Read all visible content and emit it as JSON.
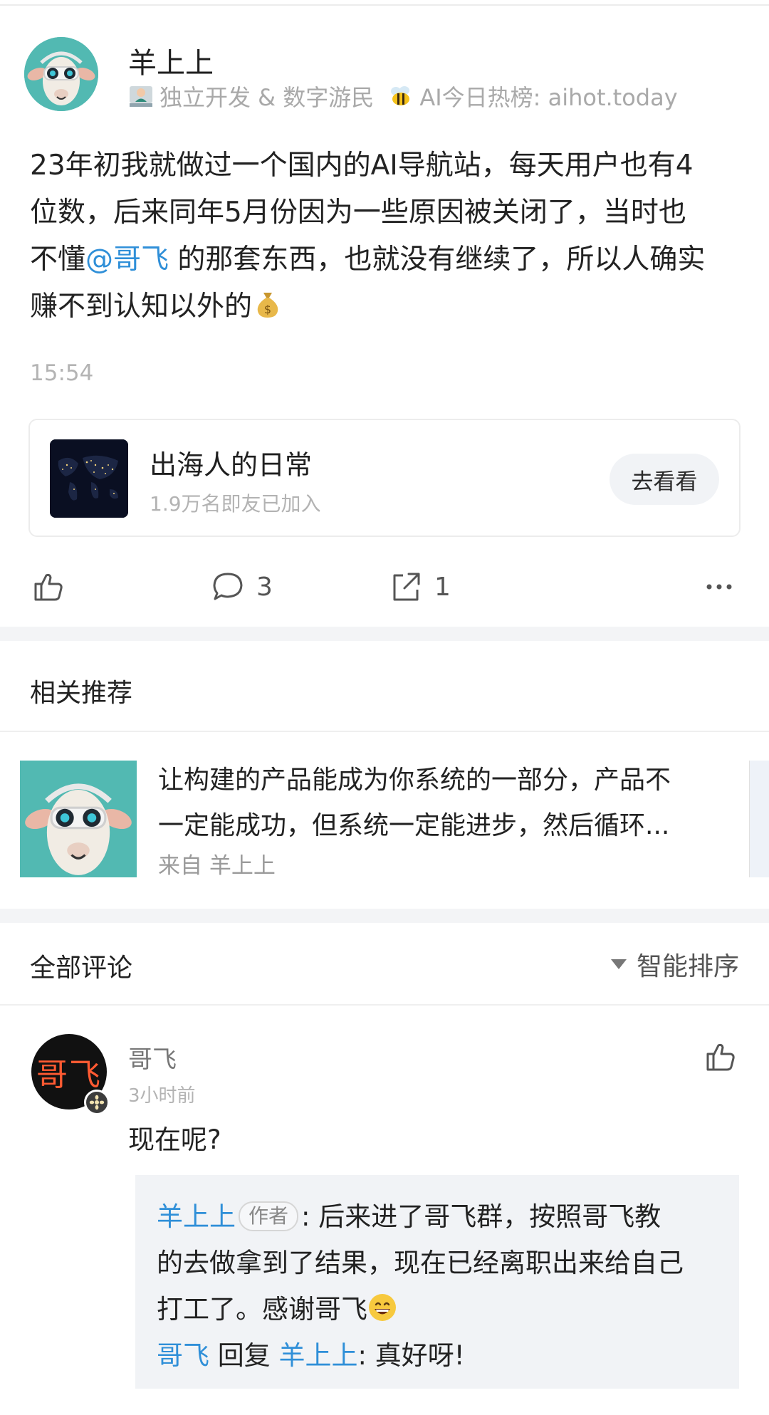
{
  "post": {
    "author": "羊上上",
    "bio_part1": "独立开发 & 数字游民",
    "bio_part2": "AI今日热榜: aihot.today",
    "text_lines": [
      "23年初我就做过一个国内的AI导航站，每天用户也有4",
      "位数，后来同年5月份因为一些原因被关闭了，当时也",
      "不懂",
      "@哥飞",
      " 的那套东西，也就没有继续了，所以人确实",
      "赚不到认知以外的"
    ],
    "time": "15:54",
    "icons": {
      "bio_emoji_1": "technologist-emoji",
      "bio_emoji_2": "bee-emoji",
      "money": "money-bag-emoji"
    }
  },
  "circle": {
    "name": "出海人的日常",
    "members": "1.9万名即友已加入",
    "button": "去看看"
  },
  "actions": {
    "like_count": "",
    "comment_count": "3",
    "share_count": "1"
  },
  "related": {
    "title": "相关推荐",
    "item_lines": [
      "让构建的产品能成为你系统的一部分，产品不",
      "一定能成功，但系统一定能进步，然后循环..."
    ],
    "source_prefix": "来自",
    "source_name": "羊上上"
  },
  "comments": {
    "title": "全部评论",
    "sort_label": "智能排序",
    "items": [
      {
        "author": "哥飞",
        "avatar_text": "哥飞",
        "time": "3小时前",
        "text": "现在呢?",
        "reply": {
          "name": "羊上上",
          "tag": "作者",
          "line1": ": 后来进了哥飞群，按照哥飞教",
          "line2": "的去做拿到了结果，现在已经离职出来给自己",
          "line3": "打工了。感谢哥飞",
          "sub_author": "哥飞",
          "sub_verb": " 回复 ",
          "sub_target": "羊上上",
          "sub_text": ": 真好呀!"
        }
      }
    ]
  },
  "colors": {
    "link": "#2f8fd8",
    "muted": "#a9a9a9",
    "panel": "#f1f3f6"
  }
}
